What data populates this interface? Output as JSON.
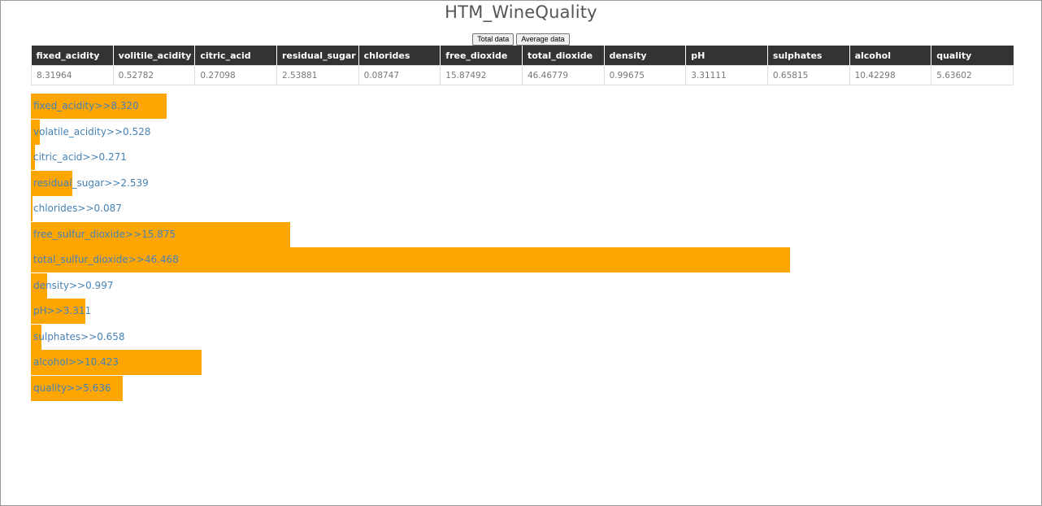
{
  "header": {
    "title": "HTM_WineQuality"
  },
  "toolbar": {
    "total_label": "Total data",
    "average_label": "Average data"
  },
  "table": {
    "columns": [
      "fixed_acidity",
      "volitile_acidity",
      "citric_acid",
      "residual_sugar",
      "chlorides",
      "free_dioxide",
      "total_dioxide",
      "density",
      "pH",
      "sulphates",
      "alcohol",
      "quality"
    ],
    "rows": [
      [
        "8.31964",
        "0.52782",
        "0.27098",
        "2.53881",
        "0.08747",
        "15.87492",
        "46.46779",
        "0.99675",
        "3.31111",
        "0.65815",
        "10.42298",
        "5.63602"
      ]
    ]
  },
  "colors": {
    "bar": "#ffa500",
    "bar_label": "#4682b4",
    "table_header_bg": "#333333"
  },
  "chart_data": {
    "type": "bar",
    "orientation": "horizontal",
    "bar_color": "#ffa500",
    "bars": [
      {
        "label": "fixed_acidity>>8.320",
        "value": 8.32
      },
      {
        "label": "volatile_acidity>>0.528",
        "value": 0.528
      },
      {
        "label": "citric_acid>>0.271",
        "value": 0.271
      },
      {
        "label": "residual_sugar>>2.539",
        "value": 2.539
      },
      {
        "label": "chlorides>>0.087",
        "value": 0.087
      },
      {
        "label": "free_sulfur_dioxide>>15.875",
        "value": 15.875
      },
      {
        "label": "total_sulfur_dioxide>>46.468",
        "value": 46.468
      },
      {
        "label": "density>>0.997",
        "value": 0.997
      },
      {
        "label": "pH>>3.311",
        "value": 3.311
      },
      {
        "label": "sulphates>>0.658",
        "value": 0.658
      },
      {
        "label": "alcohol>>10.423",
        "value": 10.423
      },
      {
        "label": "quality>>5.636",
        "value": 5.636
      }
    ]
  }
}
